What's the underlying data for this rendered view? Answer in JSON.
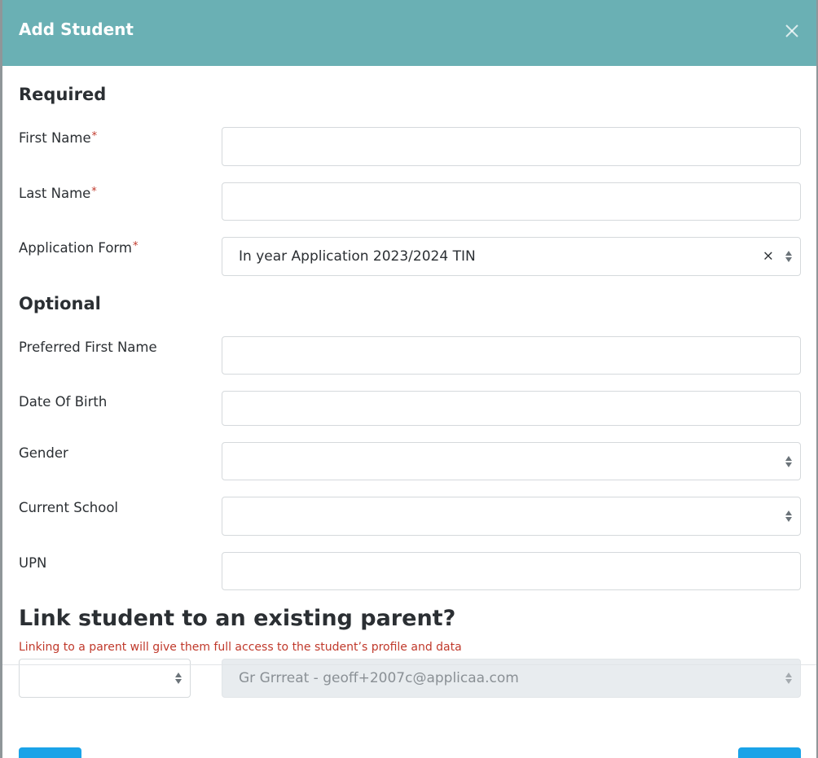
{
  "modal": {
    "title": "Add Student"
  },
  "required": {
    "heading": "Required",
    "first_name_label": "First Name",
    "last_name_label": "Last Name",
    "application_form_label": "Application Form",
    "required_marker": "*",
    "application_form_value": "In year Application 2023/2024 TIN",
    "clear_symbol": "×"
  },
  "optional": {
    "heading": "Optional",
    "preferred_first_name_label": "Preferred First Name",
    "dob_label": "Date Of Birth",
    "gender_label": "Gender",
    "current_school_label": "Current School",
    "upn_label": "UPN"
  },
  "link_parent": {
    "heading": "Link student to an existing parent?",
    "hint": "Linking to a parent will give them full access to the student’s profile and data",
    "parent_value": "Gr Grrreat - geoff+2007c@applicaa.com"
  },
  "footer": {
    "left_button_label": "",
    "right_button_label": ""
  },
  "colors": {
    "header": "#6ab0b4",
    "required_marker": "#c0392b",
    "button": "#1aa3e8"
  }
}
